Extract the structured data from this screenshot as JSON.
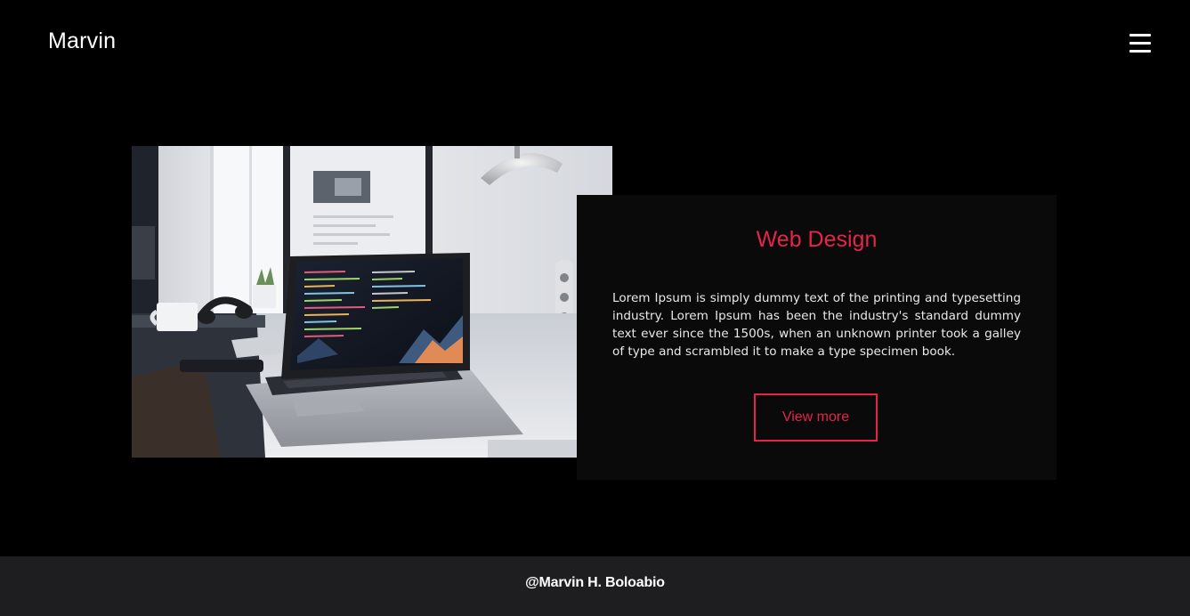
{
  "header": {
    "brand": "Marvin",
    "menu_icon": "hamburger-menu-icon"
  },
  "hero": {
    "image_alt": "hero-image",
    "card": {
      "title": "Web Design",
      "body": "Lorem Ipsum is simply dummy text of the printing and typesetting industry. Lorem Ipsum has been the industry's standard dummy text ever since the 1500s, when an unknown printer took a galley of type and scrambled it to make a type specimen book.",
      "button_label": "View more"
    }
  },
  "footer": {
    "credit": "@Marvin H. Boloabio"
  },
  "colors": {
    "background": "#000000",
    "accent": "#e6234a",
    "card_bg": "#0a0a0b",
    "footer_bg": "#1e1e20",
    "text": "#ffffff"
  }
}
